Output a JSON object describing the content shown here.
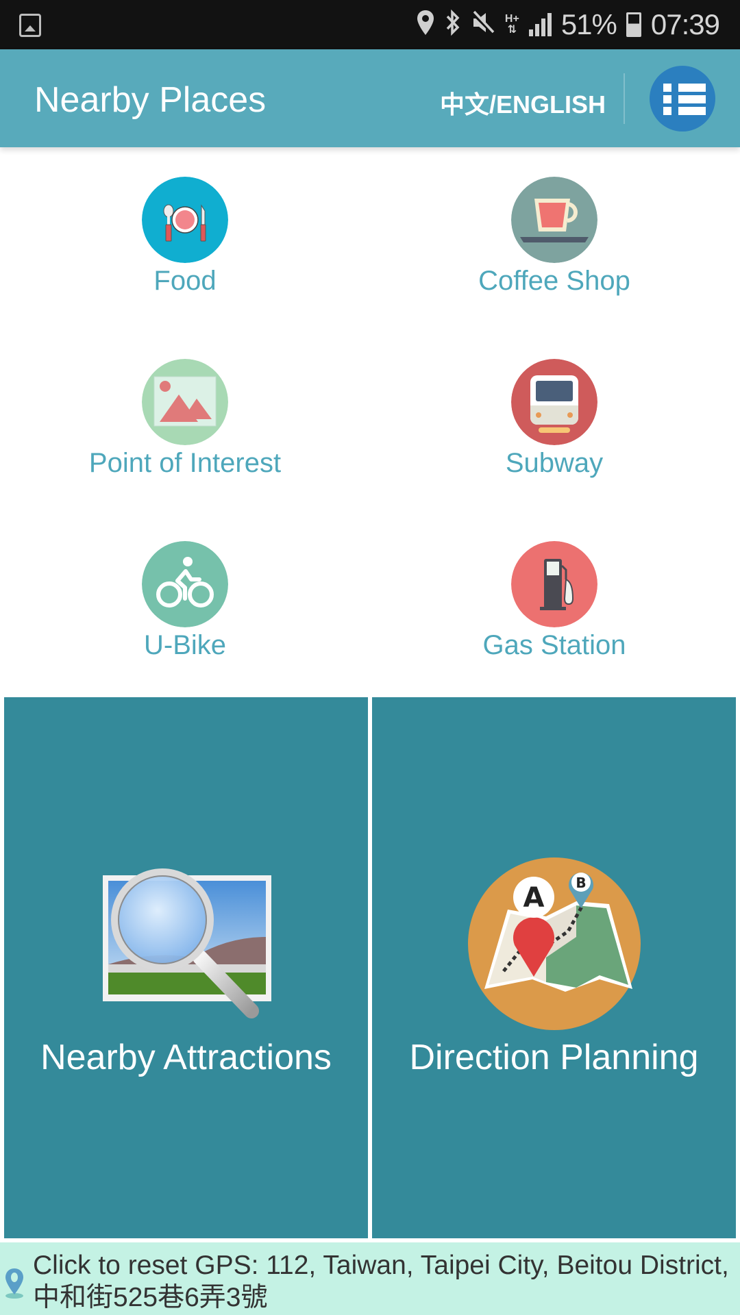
{
  "status_bar": {
    "battery": "51%",
    "time": "07:39",
    "network": "H+",
    "icons": [
      "gallery-icon",
      "location-icon",
      "bluetooth-icon",
      "mute-icon",
      "network-hplus-icon",
      "signal-icon",
      "battery-charging-icon"
    ]
  },
  "header": {
    "title": "Nearby Places",
    "language_toggle": "中文/ENGLISH",
    "menu_icon": "list-menu-icon"
  },
  "categories": [
    {
      "label": "Food",
      "icon": "food-plate-icon",
      "color": "#10aed0"
    },
    {
      "label": "Coffee Shop",
      "icon": "coffee-cup-icon",
      "color": "#7ea39f"
    },
    {
      "label": "Point of Interest",
      "icon": "landscape-picture-icon",
      "color": "#a8d9b4"
    },
    {
      "label": "Subway",
      "icon": "subway-train-icon",
      "color": "#cf5b5b"
    },
    {
      "label": "U-Bike",
      "icon": "bicycle-icon",
      "color": "#76c1ab"
    },
    {
      "label": "Gas Station",
      "icon": "gas-pump-icon",
      "color": "#ec7170"
    }
  ],
  "tiles": [
    {
      "label": "Nearby Attractions",
      "icon": "magnifier-photo-icon"
    },
    {
      "label": "Direction Planning",
      "icon": "map-route-a-b-icon"
    }
  ],
  "footer": {
    "text": "Click to reset GPS: 112, Taiwan, Taipei City, Beitou District, 中和街525巷6弄3號",
    "icon": "location-pin-icon"
  },
  "colors": {
    "header_bg": "#58aabb",
    "menu_button": "#2b7fbf",
    "category_label": "#4ea7bb",
    "tile_bg": "#348a9a",
    "footer_bg": "#c4f2e4"
  }
}
